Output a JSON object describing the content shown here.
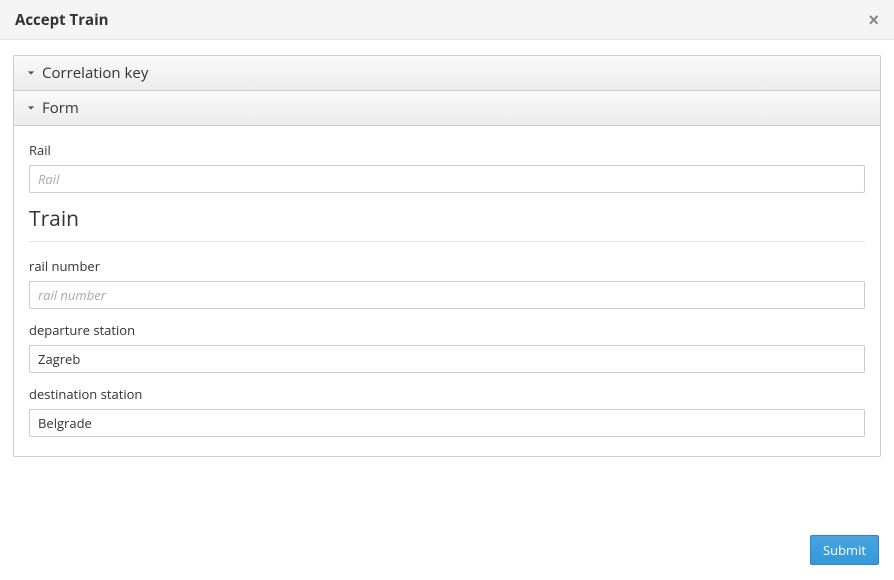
{
  "modal": {
    "title": "Accept Train",
    "close_label": "×"
  },
  "panels": {
    "correlation": {
      "title": "Correlation key"
    },
    "form": {
      "title": "Form"
    }
  },
  "form": {
    "rail": {
      "label": "Rail",
      "placeholder": "Rail",
      "value": ""
    },
    "section_title": "Train",
    "rail_number": {
      "label": "rail number",
      "placeholder": "rail number",
      "value": ""
    },
    "departure_station": {
      "label": "departure station",
      "placeholder": "",
      "value": "Zagreb"
    },
    "destination_station": {
      "label": "destination station",
      "placeholder": "",
      "value": "Belgrade"
    }
  },
  "footer": {
    "submit_label": "Submit"
  }
}
